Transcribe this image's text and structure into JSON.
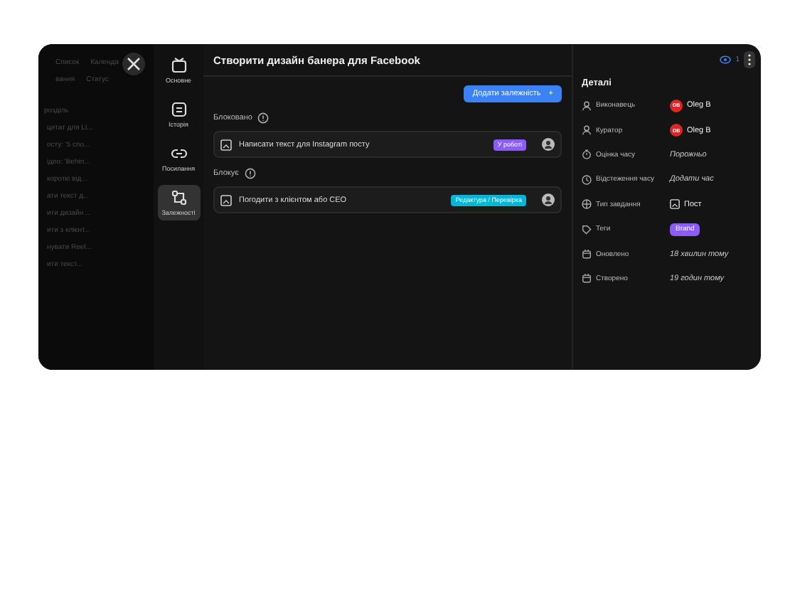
{
  "background": {
    "views": [
      "Список",
      "Календа"
    ],
    "filters": [
      "вання",
      "Статус"
    ],
    "column": "розділь",
    "rows": [
      "цитат для Li...",
      "осту: '5 спо...",
      "ідео: 'Behin...",
      "короткі від...",
      "ати текст д...",
      "ити дизайн ...",
      "ити з клієнт...",
      "нувати Reel...",
      "ити текст..."
    ]
  },
  "nav": [
    {
      "label": "Основне",
      "selected": false
    },
    {
      "label": "Історія",
      "selected": false
    },
    {
      "label": "Посилання",
      "selected": false
    },
    {
      "label": "Залежності",
      "selected": true
    }
  ],
  "task": {
    "title": "Створити дизайн банера для Facebook",
    "watchers": "1"
  },
  "add_button": "Додати залежність",
  "add_icon": "+",
  "sections": [
    {
      "title": "Блоковано",
      "items": [
        {
          "name": "Написати текст для Instagram посту",
          "status": "У роботі",
          "color": "#8b5cf6"
        }
      ]
    },
    {
      "title": "Блокує",
      "items": [
        {
          "name": "Погодити з клієнтом або CEO",
          "status": "Редактура / Перевірка",
          "color": "#06b6d4"
        }
      ]
    }
  ],
  "details": {
    "title": "Деталі",
    "rows": [
      {
        "label": "Виконавець",
        "kind": "user",
        "value": "Oleg B",
        "initials": "OB"
      },
      {
        "label": "Куратор",
        "kind": "user",
        "value": "Oleg B",
        "initials": "OB"
      },
      {
        "label": "Оцінка часу",
        "kind": "muted",
        "value": "Порожньо"
      },
      {
        "label": "Відстеження часу",
        "kind": "muted",
        "value": "Додати час"
      },
      {
        "label": "Тип завдання",
        "kind": "type",
        "value": "Пост"
      },
      {
        "label": "Теги",
        "kind": "tag",
        "value": "Brand",
        "color": "#8b5cf6"
      },
      {
        "label": "Оновлено",
        "kind": "muted",
        "value": "18 хвилин тому"
      },
      {
        "label": "Створено",
        "kind": "muted",
        "value": "19 годин тому"
      }
    ]
  }
}
